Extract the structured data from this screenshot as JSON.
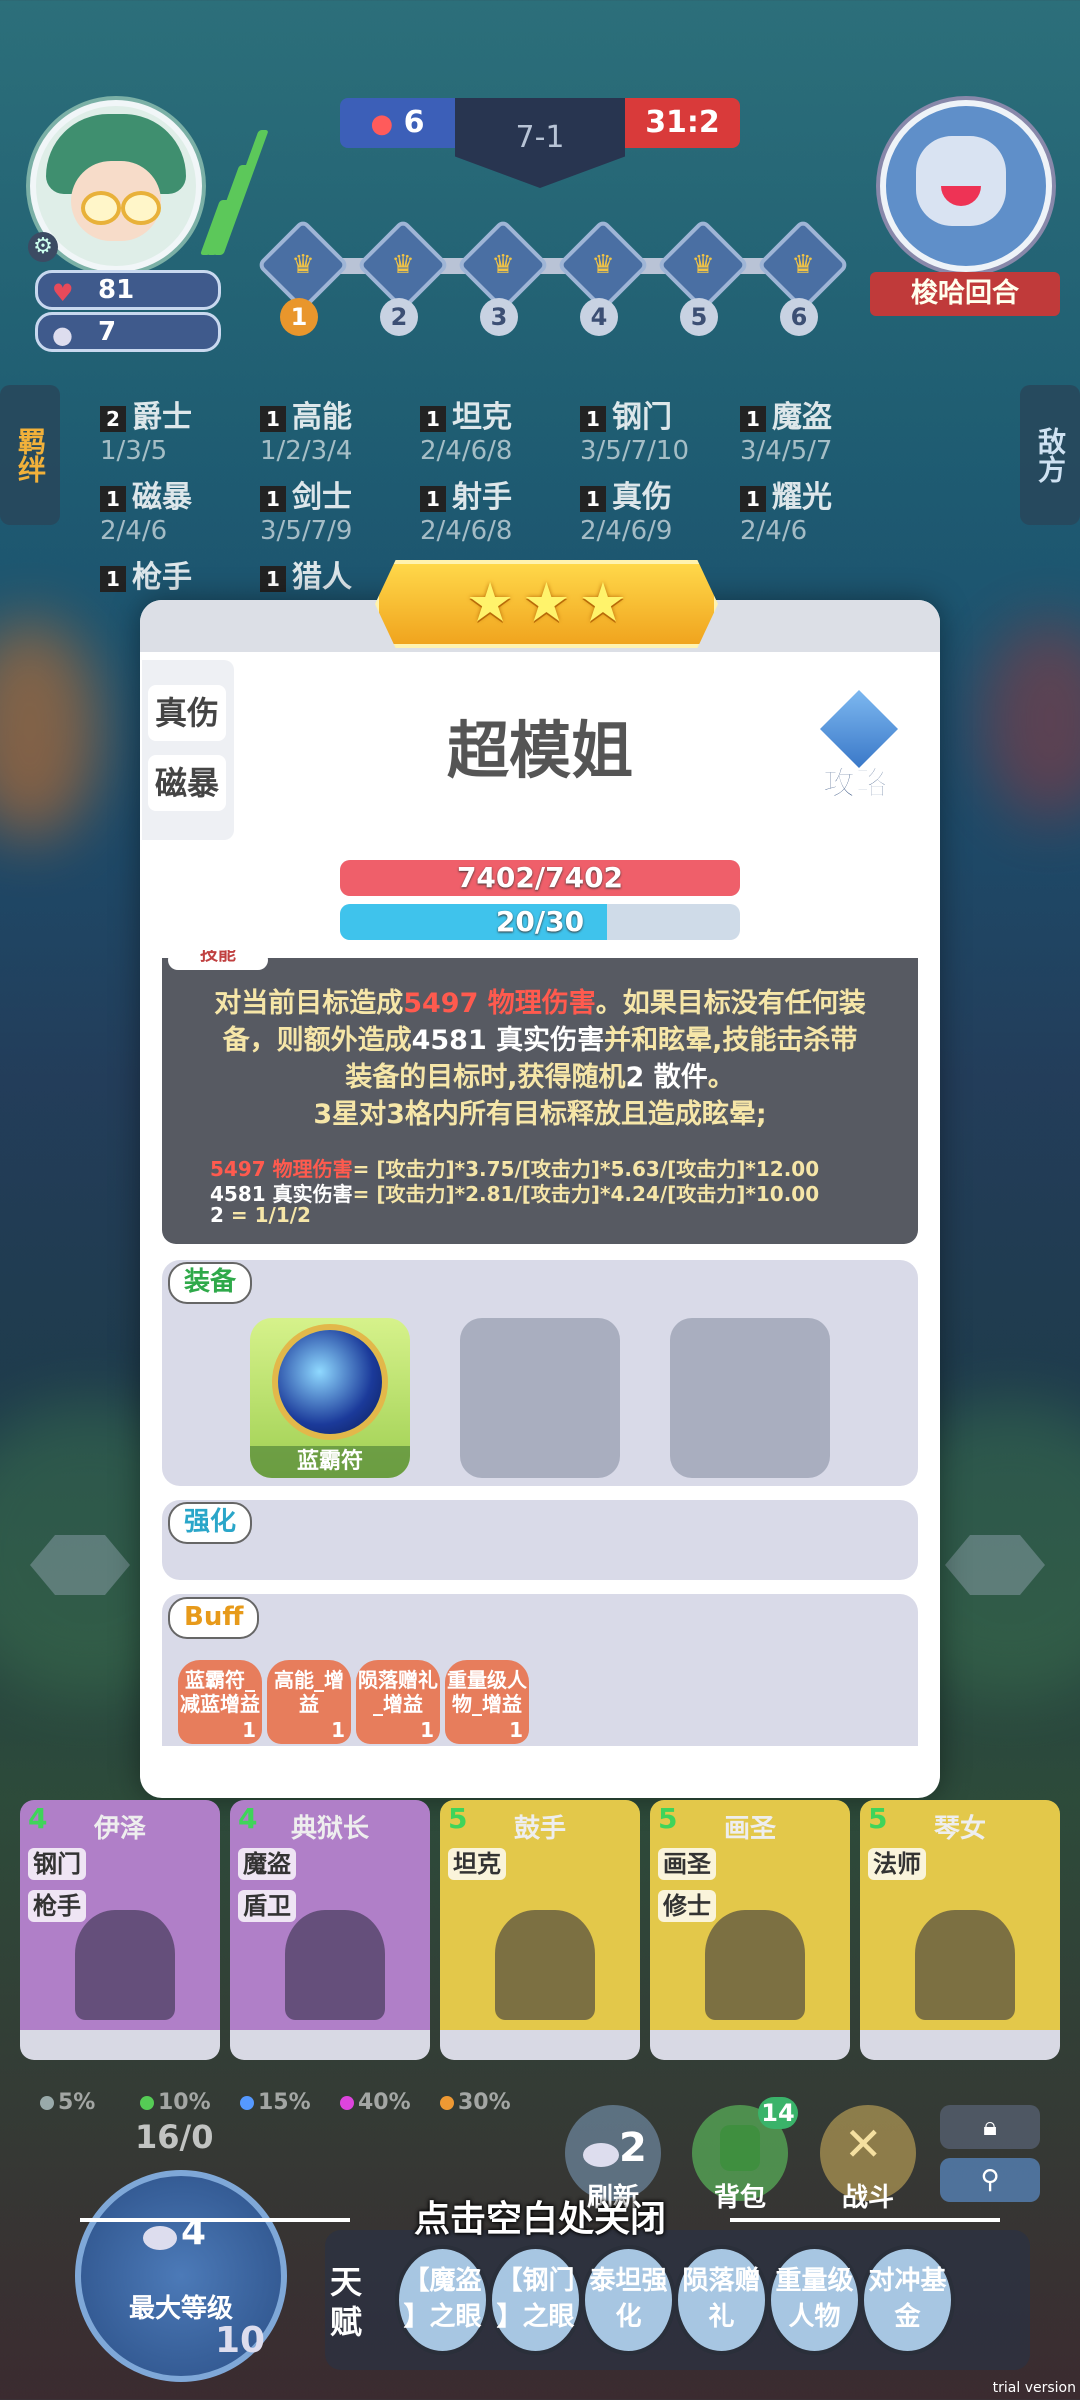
{
  "player": {
    "health": "81",
    "coins": "7"
  },
  "scoreboard": {
    "left_score": "6",
    "round": "7-1",
    "right_score": "31:2"
  },
  "round_nodes": [
    "1",
    "2",
    "3",
    "4",
    "5",
    "6"
  ],
  "enemy": {
    "name": "梭哈回合"
  },
  "tabs": {
    "traits": "羁绊",
    "enemy": "敌方"
  },
  "traits": [
    {
      "count": "2",
      "name": "爵士",
      "levels": "1/3/5"
    },
    {
      "count": "1",
      "name": "高能",
      "levels": "1/2/3/4"
    },
    {
      "count": "1",
      "name": "坦克",
      "levels": "2/4/6/8"
    },
    {
      "count": "1",
      "name": "钢门",
      "levels": "3/5/7/10"
    },
    {
      "count": "1",
      "name": "魔盗",
      "levels": "3/4/5/7"
    },
    {
      "count": "1",
      "name": "磁暴",
      "levels": "2/4/6"
    },
    {
      "count": "1",
      "name": "剑士",
      "levels": "3/5/7/9"
    },
    {
      "count": "1",
      "name": "射手",
      "levels": "2/4/6/8"
    },
    {
      "count": "1",
      "name": "真伤",
      "levels": "2/4/6/9"
    },
    {
      "count": "1",
      "name": "耀光",
      "levels": "2/4/6"
    },
    {
      "count": "1",
      "name": "枪手",
      "levels": ""
    },
    {
      "count": "1",
      "name": "猎人",
      "levels": ""
    }
  ],
  "hero": {
    "stars": 3,
    "name": "超模姐",
    "synergies": [
      "真伤",
      "磁暴"
    ],
    "guide_label": "攻略",
    "hp_text": "7402/7402",
    "hp_fraction": 1.0,
    "mana_text": "20/30",
    "mana_fraction": 0.667,
    "skill_tab": "技能",
    "skill": {
      "l1a": "对当前目标造成",
      "l1b": "5497 物理伤害",
      "l1c": "。如果目标没有任何装",
      "l2a": "备，则额外造成",
      "l2b": "4581 真实伤害",
      "l2c": "并和眩晕,技能击杀带",
      "l3a": "装备的目标时,获得随机",
      "l3b": "2 散件",
      "l3c": "。",
      "l4": "3星对3格内所有目标释放且造成眩晕;"
    },
    "formulas": [
      {
        "label": "5497 物理伤害",
        "expr": "= [攻击力]*3.75/[攻击力]*5.63/[攻击力]*12.00"
      },
      {
        "label": "4581 真实伤害",
        "expr": "= [攻击力]*2.81/[攻击力]*4.24/[攻击力]*10.00"
      },
      {
        "label": "2",
        "expr": " = 1/1/2"
      }
    ],
    "equipment_label": "装备",
    "equipment": [
      {
        "name": "蓝霸符"
      }
    ],
    "enhance_label": "强化",
    "buff_label": "Buff",
    "buffs": [
      {
        "l1": "蓝霸符_",
        "l2": "减蓝增益",
        "count": "1"
      },
      {
        "l1": "高能_增",
        "l2": "益",
        "count": "1"
      },
      {
        "l1": "陨落赠礼",
        "l2": "_增益",
        "count": "1"
      },
      {
        "l1": "重量级人",
        "l2": "物_增益",
        "count": "1"
      }
    ]
  },
  "shop": [
    {
      "cost": "4",
      "name": "伊泽",
      "tags": [
        "钢门",
        "枪手"
      ],
      "color": "#b07fc8"
    },
    {
      "cost": "4",
      "name": "典狱长",
      "tags": [
        "魔盗",
        "盾卫"
      ],
      "color": "#b07fc8"
    },
    {
      "cost": "5",
      "name": "鼓手",
      "tags": [
        "坦克"
      ],
      "color": "#e3c84a"
    },
    {
      "cost": "5",
      "name": "画圣",
      "tags": [
        "画圣",
        "修士"
      ],
      "color": "#e3c84a"
    },
    {
      "cost": "5",
      "name": "琴女",
      "tags": [
        "法师"
      ],
      "color": "#e3c84a"
    }
  ],
  "odds": [
    {
      "value": "5%",
      "color": "#9aa"
    },
    {
      "value": "10%",
      "color": "#5c5"
    },
    {
      "value": "15%",
      "color": "#59f"
    },
    {
      "value": "40%",
      "color": "#d4d"
    },
    {
      "value": "30%",
      "color": "#e93"
    }
  ],
  "level": {
    "xp": "16/0",
    "cost": "4",
    "label": "最大等级",
    "level": "10"
  },
  "actions": {
    "refresh": "刷新",
    "refresh_cost": "2",
    "bag": "背包",
    "bag_count": "14",
    "battle": "战斗"
  },
  "close_hint": "点击空白处关闭",
  "talent": {
    "label": "天赋",
    "items": [
      {
        "l1": "【魔盗",
        "l2": "】之眼"
      },
      {
        "l1": "【钢门",
        "l2": "】之眼"
      },
      {
        "l1": "泰坦强",
        "l2": "化"
      },
      {
        "l1": "陨落赠",
        "l2": "礼"
      },
      {
        "l1": "重量级",
        "l2": "人物"
      },
      {
        "l1": "对冲基",
        "l2": "金"
      }
    ]
  },
  "watermark": "trial version"
}
